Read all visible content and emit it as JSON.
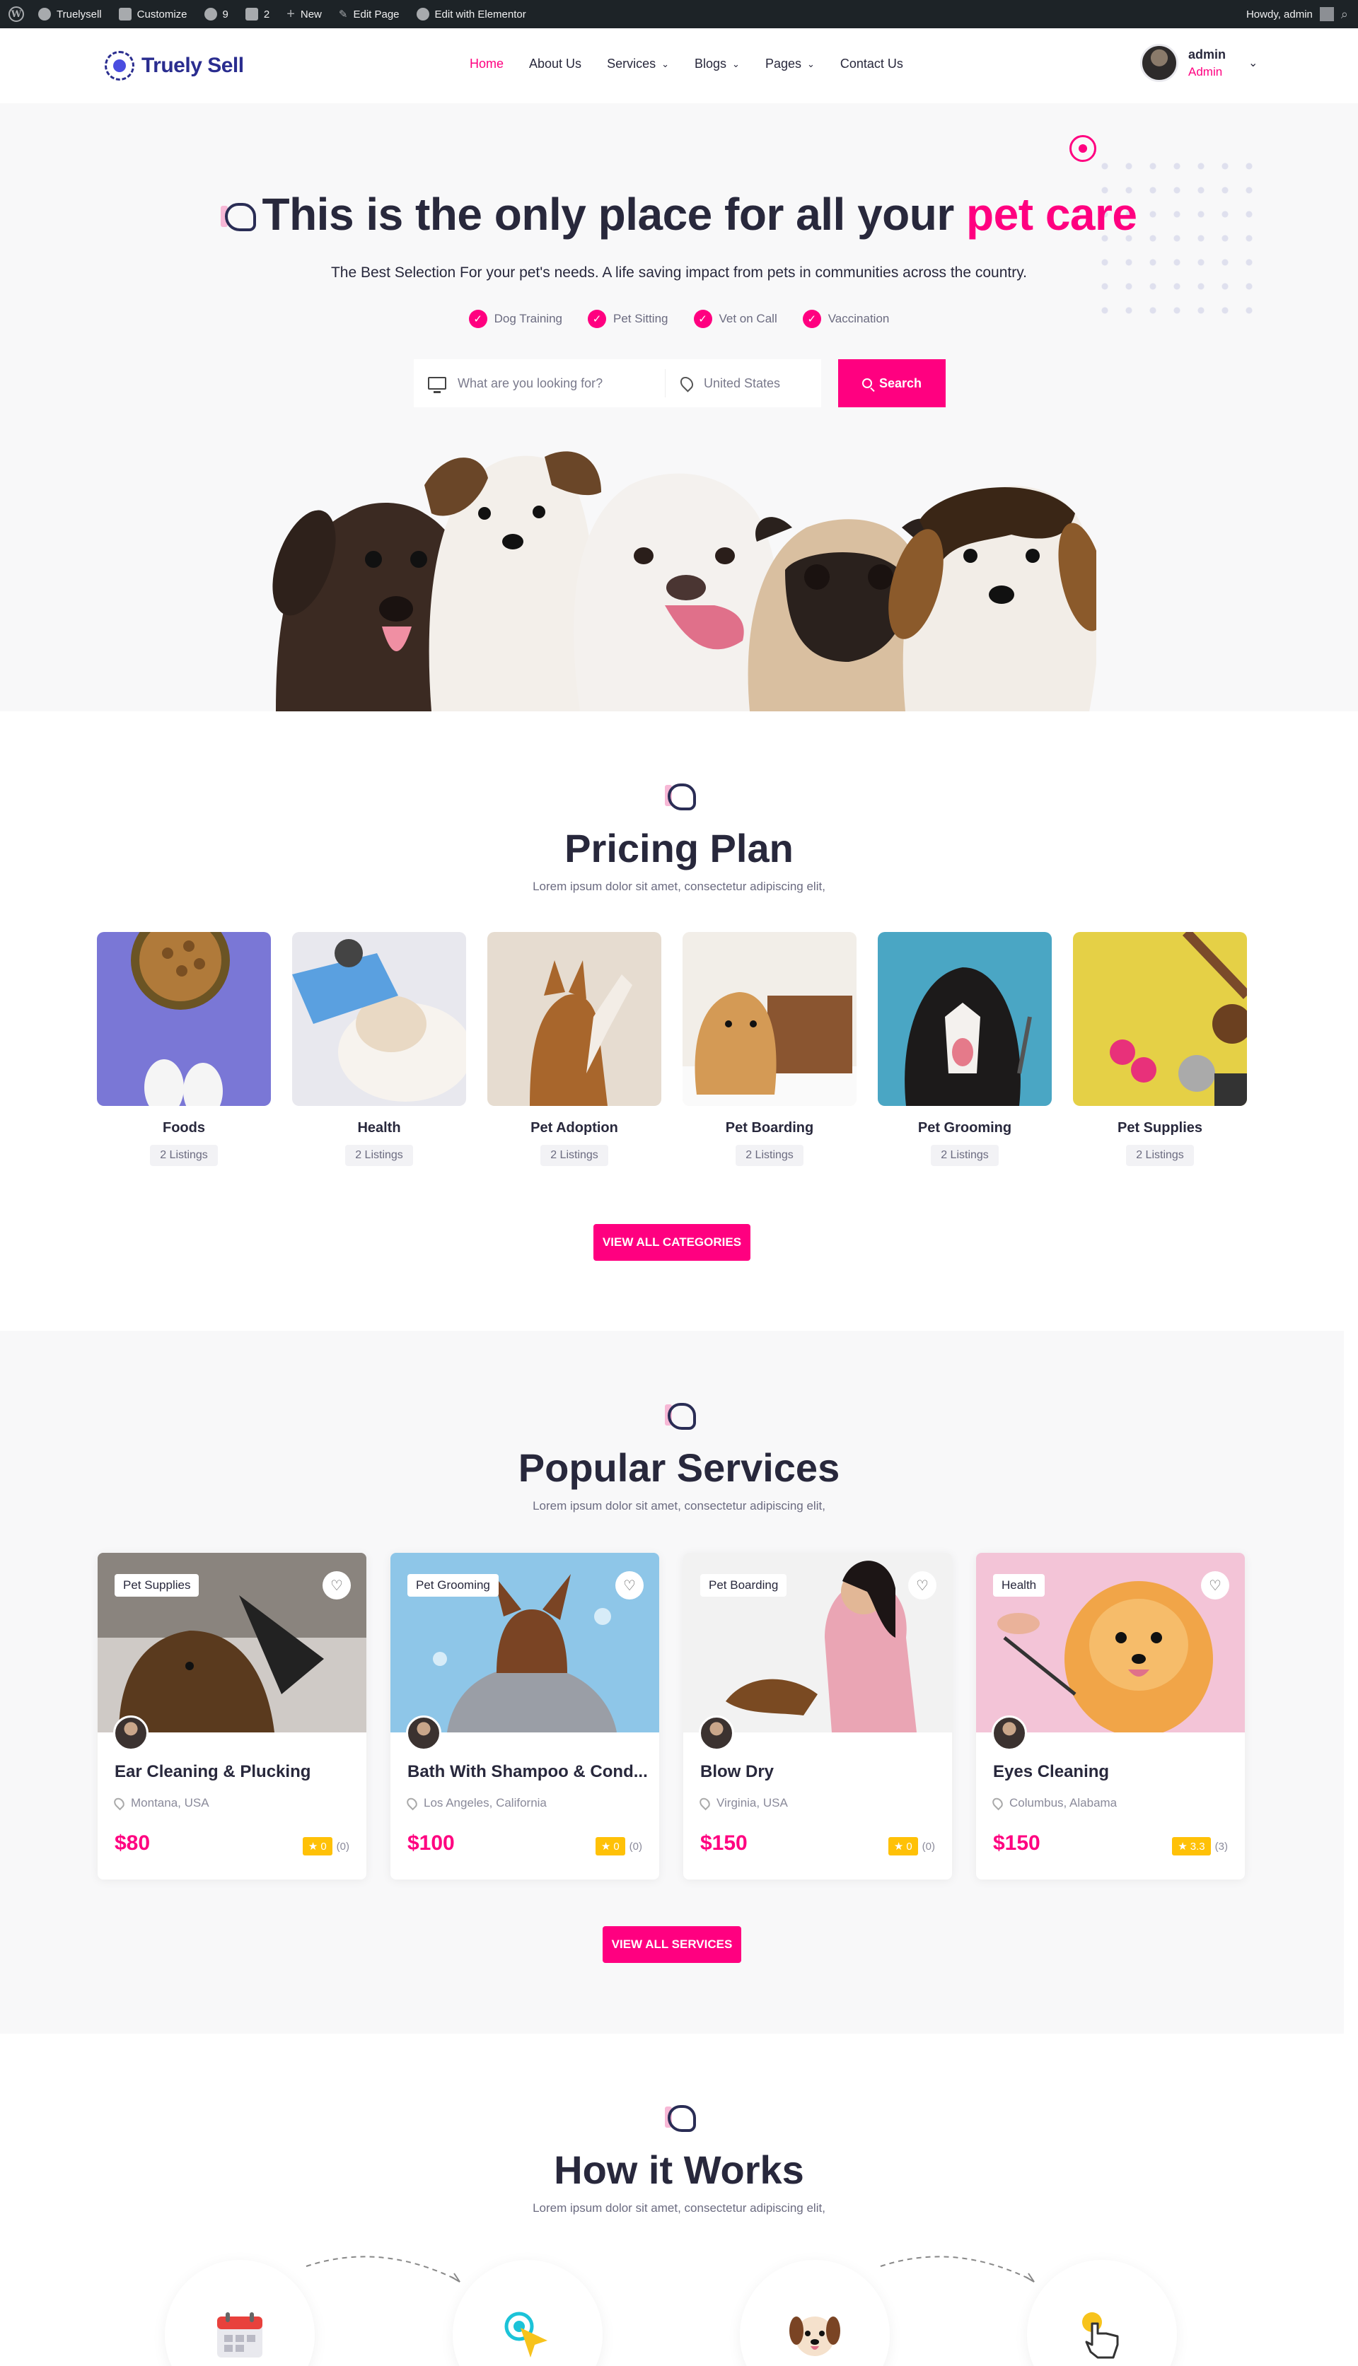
{
  "adminbar": {
    "site": "Truelysell",
    "customize": "Customize",
    "updates": "9",
    "comments": "2",
    "new": "New",
    "edit_page": "Edit Page",
    "elementor": "Edit with Elementor",
    "howdy": "Howdy, admin"
  },
  "header": {
    "logo_text": "Truely Sell",
    "nav": [
      {
        "label": "Home",
        "active": true,
        "dropdown": false
      },
      {
        "label": "About Us",
        "active": false,
        "dropdown": false
      },
      {
        "label": "Services",
        "active": false,
        "dropdown": true
      },
      {
        "label": "Blogs",
        "active": false,
        "dropdown": true
      },
      {
        "label": "Pages",
        "active": false,
        "dropdown": true
      },
      {
        "label": "Contact Us",
        "active": false,
        "dropdown": false
      }
    ],
    "user_name": "admin",
    "user_role": "Admin"
  },
  "hero": {
    "title_main": "This is the only place for all your ",
    "title_accent": "pet care",
    "subtitle": "The Best Selection For your pet's needs. A life saving impact from pets in communities across the country.",
    "tags": [
      "Dog Training",
      "Pet Sitting",
      "Vet on Call",
      "Vaccination"
    ],
    "search_placeholder": "What are you looking for?",
    "location_value": "United States",
    "search_button": "Search"
  },
  "pricing": {
    "title": "Pricing Plan",
    "subtitle": "Lorem ipsum dolor sit amet, consectetur adipiscing elit,",
    "categories": [
      {
        "name": "Foods",
        "count": "2 Listings"
      },
      {
        "name": "Health",
        "count": "2 Listings"
      },
      {
        "name": "Pet Adoption",
        "count": "2 Listings"
      },
      {
        "name": "Pet Boarding",
        "count": "2 Listings"
      },
      {
        "name": "Pet Grooming",
        "count": "2 Listings"
      },
      {
        "name": "Pet Supplies",
        "count": "2 Listings"
      }
    ],
    "button": "VIEW ALL CATEGORIES"
  },
  "services": {
    "title": "Popular Services",
    "subtitle": "Lorem ipsum dolor sit amet, consectetur adipiscing elit,",
    "items": [
      {
        "category": "Pet Supplies",
        "title": "Ear Cleaning & Plucking",
        "location": "Montana, USA",
        "price": "$80",
        "rating": "0",
        "reviews": "(0)"
      },
      {
        "category": "Pet Grooming",
        "title": "Bath With Shampoo & Cond...",
        "location": "Los Angeles, California",
        "price": "$100",
        "rating": "0",
        "reviews": "(0)"
      },
      {
        "category": "Pet Boarding",
        "title": "Blow Dry",
        "location": "Virginia, USA",
        "price": "$150",
        "rating": "0",
        "reviews": "(0)"
      },
      {
        "category": "Health",
        "title": "Eyes Cleaning",
        "location": "Columbus, Alabama",
        "price": "$150",
        "rating": "3.3",
        "reviews": "(3)"
      }
    ],
    "button": "VIEW ALL SERVICES"
  },
  "how": {
    "title": "How it Works",
    "subtitle": "Lorem ipsum dolor sit amet, consectetur adipiscing elit,"
  },
  "colors": {
    "accent": "#ff0080",
    "dark": "#28283c",
    "adminbar": "#1d2327",
    "rating": "#ffc107"
  }
}
